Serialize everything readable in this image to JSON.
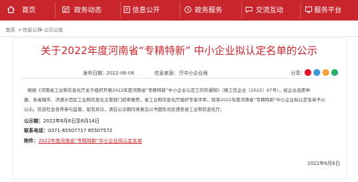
{
  "nav": {
    "items": [
      "首页",
      "政务动态",
      "信息公开",
      "政务服务",
      "交流互动",
      "服务平台"
    ],
    "active": "信息公开"
  },
  "breadcrumb": [
    "首页",
    "信息公开",
    "公示公告"
  ],
  "article": {
    "title": "关于2022年度河南省“专精特新” 中小企业拟认定名单的公示",
    "publish_label": "发布日期：",
    "publish_date": "2022-06-06",
    "source_label": "信息来源：",
    "source": "厅中小企业局",
    "share_label": "分享：",
    "paragraph_lines": [
      "根据《河南省工业和信息化厅关于组织开展2022年度河南省“专精特新”中小企业认定工作的通知》（豫工信企业〔2022〕67号），经企业自愿申",
      "报，各省辖市、济源示范区工业和信息化主管部门初审推荐，省工业和信息化厅组织专家评审，现将2022年度河南省“专精特新”中小企业拟认定名单予以",
      "公示。欢迎社会各界参与监督，如有异议，请在公示期内将意见以书面形式反馈至省工业和信息化厅。"
    ],
    "period_label": "公示期：",
    "period": "2022年6月6日至6月14日",
    "phone_label": "联系电话：",
    "phone": "0371-65507717  65507572",
    "attachment_label": "附件：",
    "attachment": "2022年度河南省“专精特新”中小企业拟认定名单",
    "sign_date": "2022年6月6日"
  },
  "colors": {
    "brand": "#c8252c",
    "share_icons": [
      "#e6162d",
      "#3b99d8",
      "#f4a23a",
      "#2aae67"
    ]
  }
}
